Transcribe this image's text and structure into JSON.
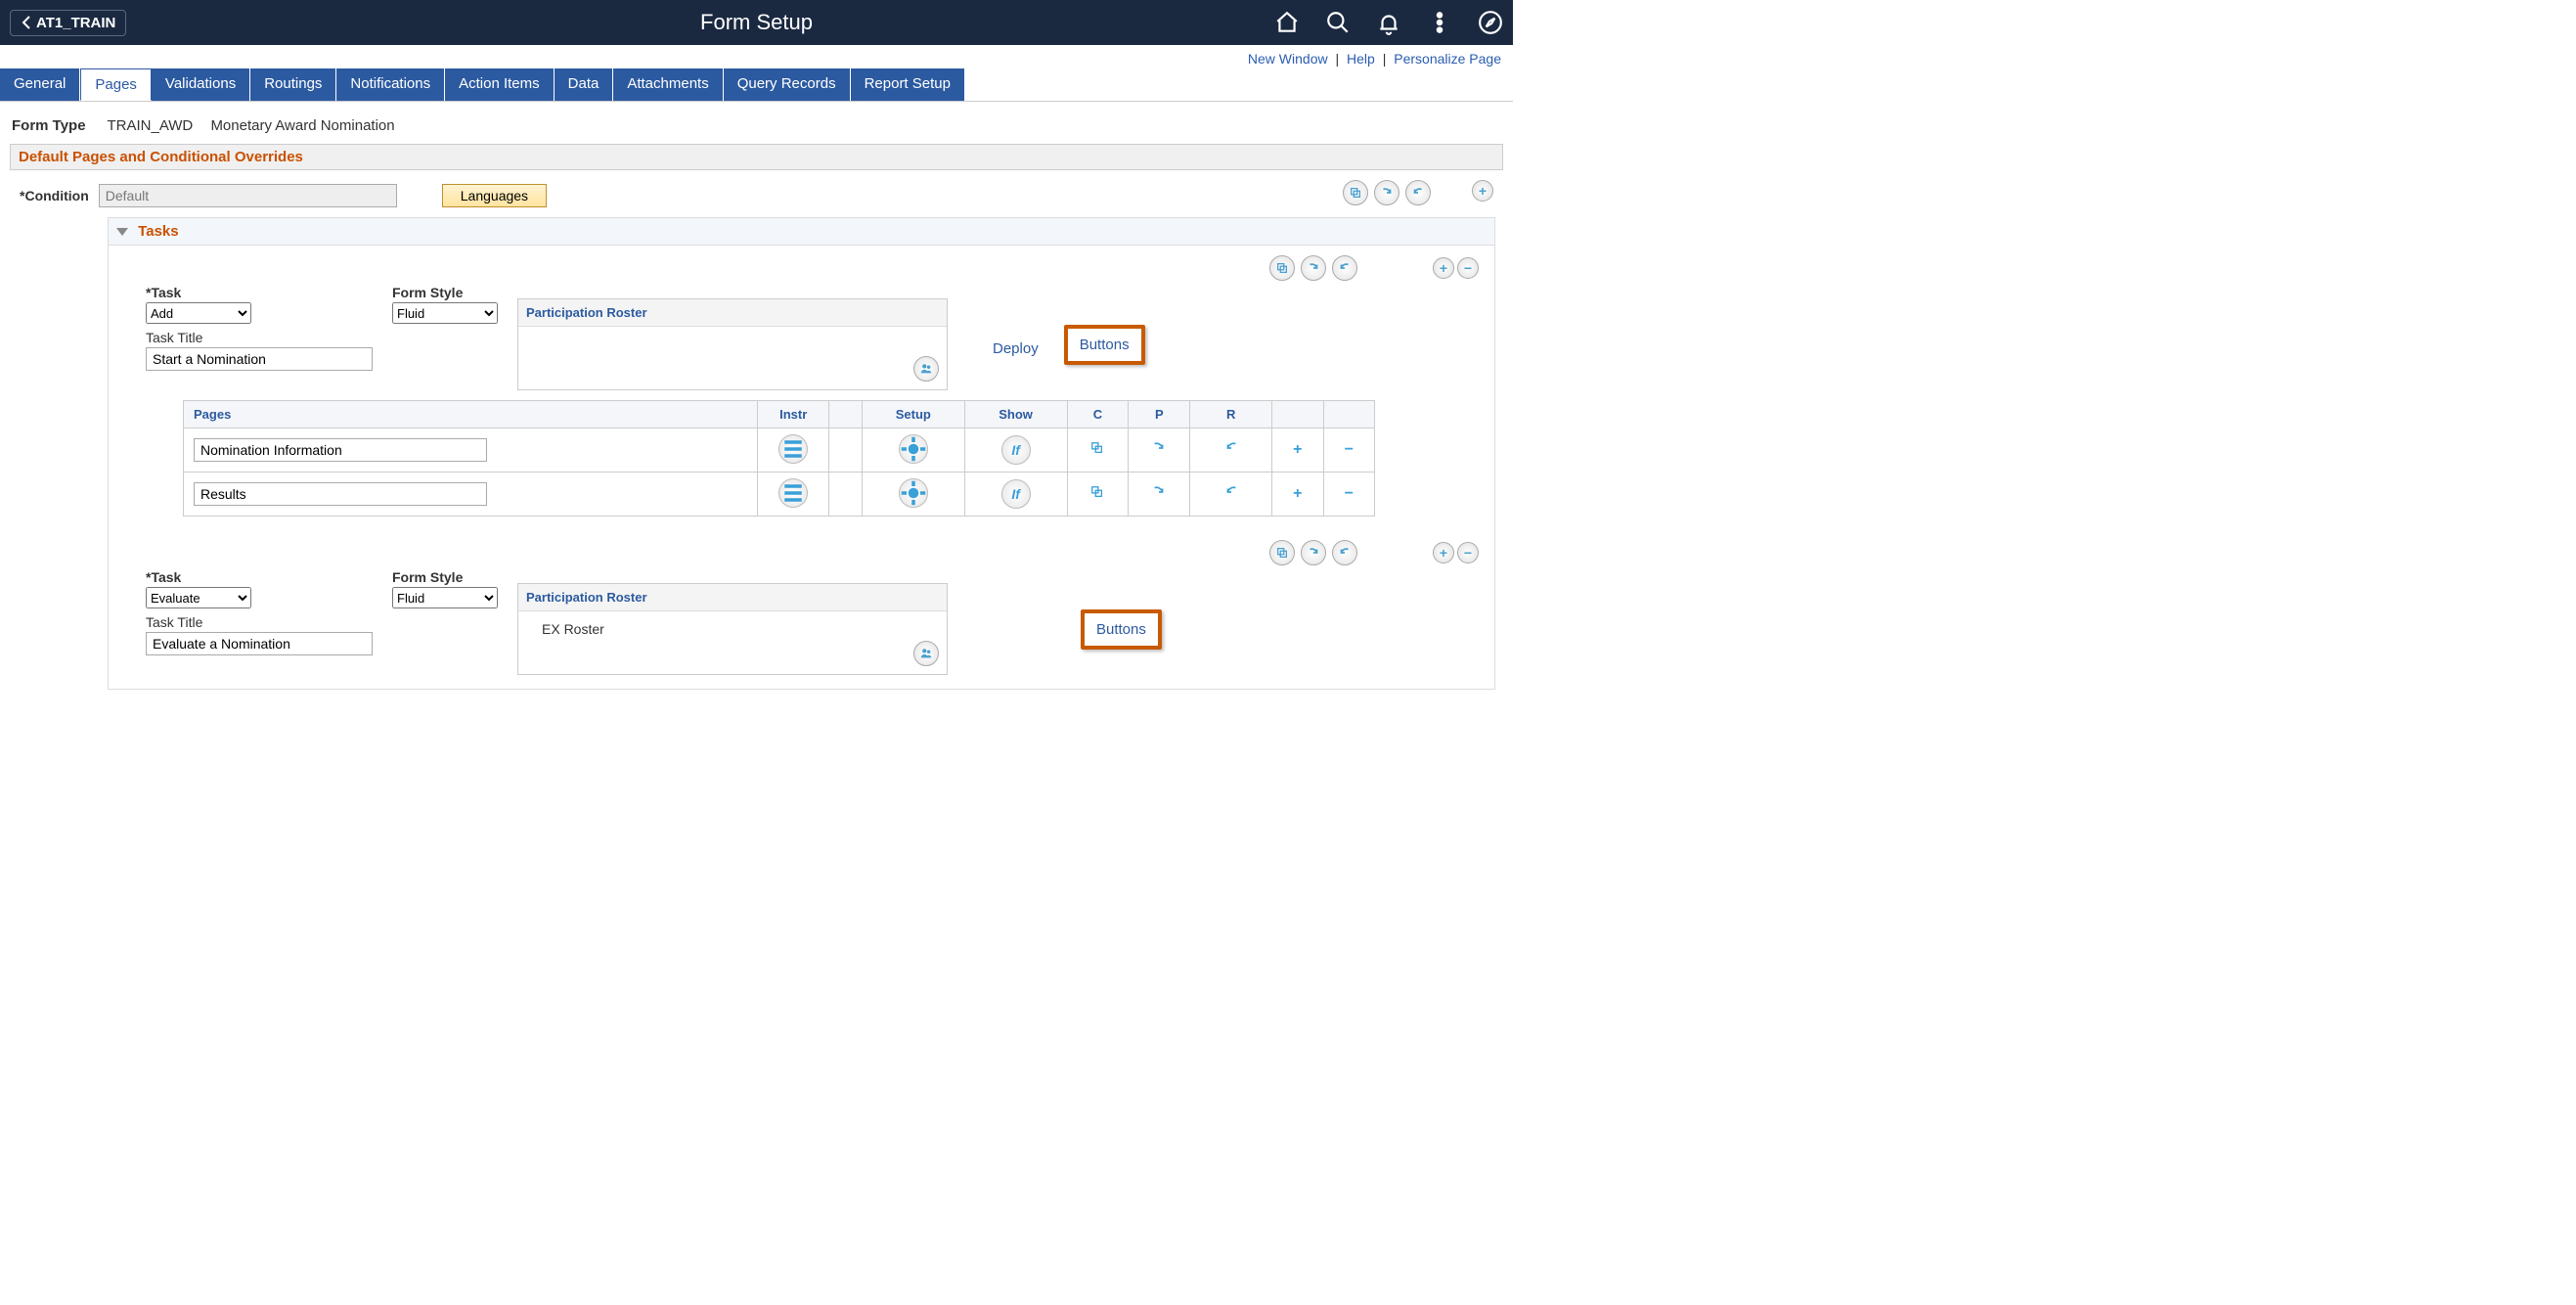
{
  "header": {
    "back_label": "AT1_TRAIN",
    "title": "Form Setup"
  },
  "util_links": {
    "new_window": "New Window",
    "help": "Help",
    "personalize": "Personalize Page"
  },
  "tabs": [
    "General",
    "Pages",
    "Validations",
    "Routings",
    "Notifications",
    "Action Items",
    "Data",
    "Attachments",
    "Query Records",
    "Report Setup"
  ],
  "active_tab": 1,
  "form_type": {
    "label": "Form Type",
    "code": "TRAIN_AWD",
    "desc": "Monetary Award Nomination"
  },
  "section_title": "Default Pages and Conditional Overrides",
  "condition": {
    "label": "Condition",
    "value": "Default",
    "languages_btn": "Languages"
  },
  "tasks_header": "Tasks",
  "tasks": [
    {
      "task_label": "Task",
      "task_value": "Add",
      "form_style_label": "Form Style",
      "form_style_value": "Fluid",
      "roster_label": "Participation Roster",
      "roster_body": "",
      "deploy": "Deploy",
      "buttons": "Buttons",
      "task_title_label": "Task Title",
      "task_title_value": "Start a Nomination",
      "show_deploy": true,
      "pages_grid": {
        "headers": {
          "pages": "Pages",
          "instr": "Instr",
          "setup": "Setup",
          "show": "Show",
          "c": "C",
          "p": "P",
          "r": "R"
        },
        "rows": [
          {
            "name": "Nomination Information"
          },
          {
            "name": "Results"
          }
        ]
      }
    },
    {
      "task_label": "Task",
      "task_value": "Evaluate",
      "form_style_label": "Form Style",
      "form_style_value": "Fluid",
      "roster_label": "Participation Roster",
      "roster_body": "EX Roster",
      "buttons": "Buttons",
      "task_title_label": "Task Title",
      "task_title_value": "Evaluate a Nomination",
      "show_deploy": false
    }
  ]
}
